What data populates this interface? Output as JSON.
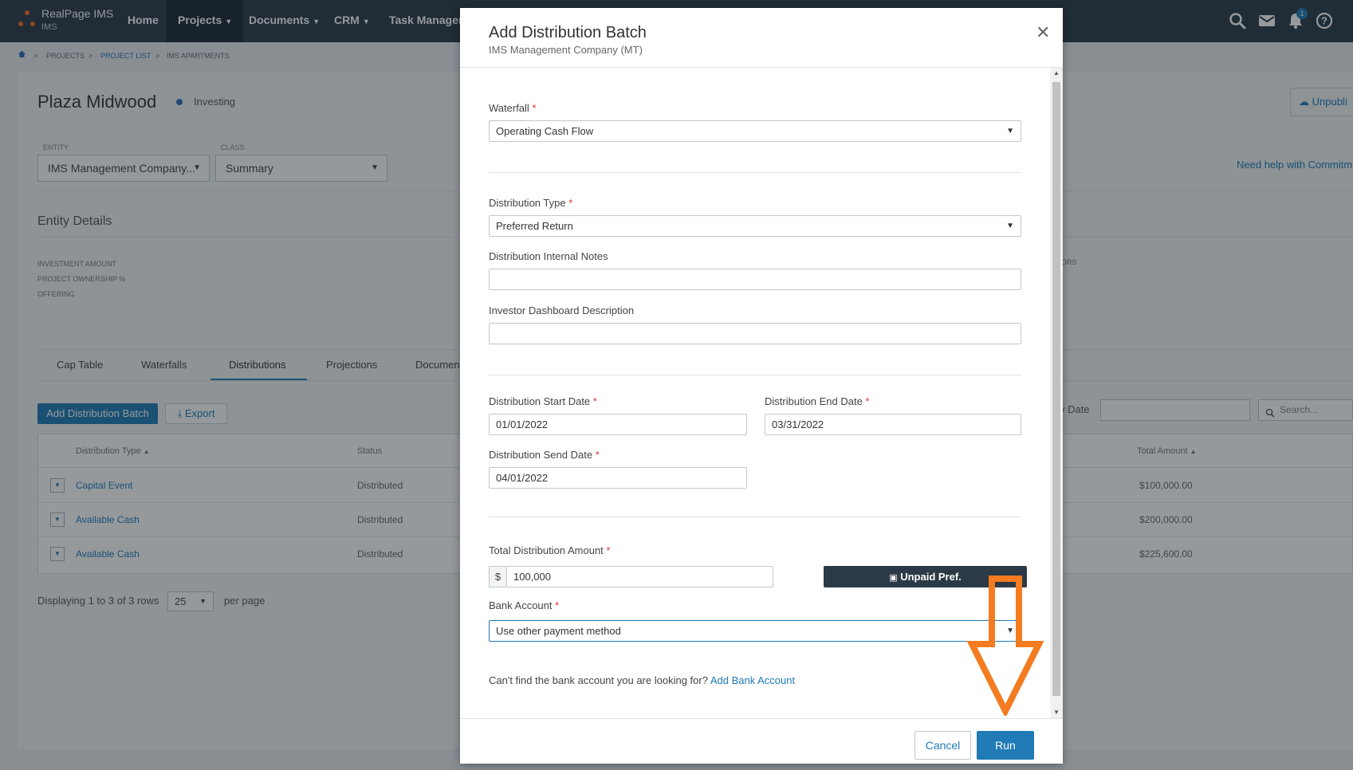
{
  "nav": {
    "brand_name": "RealPage IMS",
    "brand_sub": "IMS",
    "items": [
      {
        "label": "Home",
        "has_caret": false
      },
      {
        "label": "Projects",
        "has_caret": true
      },
      {
        "label": "Documents",
        "has_caret": true
      },
      {
        "label": "CRM",
        "has_caret": true
      },
      {
        "label": "Task Manager",
        "has_caret": false
      }
    ],
    "notification_count": "1",
    "icons": [
      "search-icon",
      "mail-icon",
      "bell-icon",
      "help-icon"
    ]
  },
  "breadcrumb": [
    "PROJECTS",
    "PROJECT LIST",
    "IMS APARTMENTS"
  ],
  "page": {
    "title": "Plaza Midwood",
    "status": "Investing",
    "unpublish_label": "Unpubli",
    "entity_label": "ENTITY",
    "entity_value": "IMS Management Company...",
    "class_label": "CLASS",
    "class_value": "Summary",
    "help_link": "Need help with Commitm",
    "entity_details_title": "Entity Details",
    "details": [
      "INVESTMENT AMOUNT",
      "PROJECT OWNERSHIP %",
      "OFFERING"
    ],
    "right_fragment": "ORS",
    "tabs": [
      "Cap Table",
      "Waterfalls",
      "Distributions",
      "Projections",
      "Documen"
    ],
    "add_batch_label": "Add Distribution Batch",
    "export_label": "Export",
    "date_label": "y Date",
    "search_placeholder": "Search...",
    "table": {
      "headers": {
        "type": "Distribution Type",
        "status": "Status",
        "total": "Total Amount"
      },
      "rows": [
        {
          "type": "Capital Event",
          "status": "Distributed",
          "total": "$100,000.00"
        },
        {
          "type": "Available Cash",
          "status": "Distributed",
          "total": "$200,000.00"
        },
        {
          "type": "Available Cash",
          "status": "Distributed",
          "total": "$225,600.00"
        }
      ]
    },
    "pager_text": "Displaying 1 to 3 of 3 rows",
    "page_size": "25",
    "per_page_label": "per page"
  },
  "modal": {
    "title": "Add Distribution Batch",
    "subtitle": "IMS Management Company (MT)",
    "waterfall_label": "Waterfall",
    "waterfall_value": "Operating Cash Flow",
    "dist_type_label": "Distribution Type",
    "dist_type_value": "Preferred Return",
    "internal_notes_label": "Distribution Internal Notes",
    "internal_notes_value": "",
    "investor_desc_label": "Investor Dashboard Description",
    "investor_desc_value": "",
    "start_date_label": "Distribution Start Date",
    "start_date_value": "01/01/2022",
    "end_date_label": "Distribution End Date",
    "end_date_value": "03/31/2022",
    "send_date_label": "Distribution Send Date",
    "send_date_value": "04/01/2022",
    "total_amount_label": "Total Distribution Amount",
    "currency_symbol": "$",
    "total_amount_value": "100,000",
    "unpaid_pref_label": "Unpaid Pref.",
    "bank_account_label": "Bank Account",
    "bank_account_value": "Use other payment method",
    "bank_help_text": "Can't find the bank account you are looking for?",
    "add_bank_link": "Add Bank Account",
    "cancel_label": "Cancel",
    "run_label": "Run",
    "required_mark": "*"
  },
  "colors": {
    "nav_bg": "#2b3a46",
    "accent": "#1f7ab5",
    "brand_orange": "#f26b24",
    "annotation_arrow": "#f47b20",
    "required": "#d33333"
  }
}
